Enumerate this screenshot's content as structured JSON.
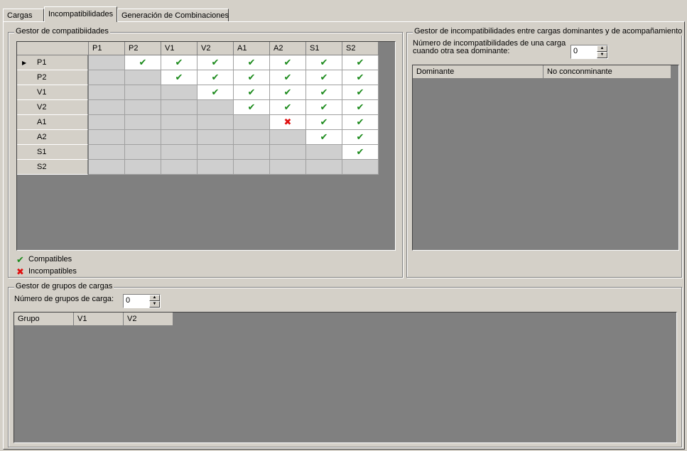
{
  "tabs": [
    {
      "label": "Cargas"
    },
    {
      "label": "Incompatibilidades"
    },
    {
      "label": "Generación de Combinaciones"
    }
  ],
  "compat": {
    "title": "Gestor de compatibiidades",
    "columns": [
      "P1",
      "P2",
      "V1",
      "V2",
      "A1",
      "A2",
      "S1",
      "S2"
    ],
    "rows": [
      {
        "label": "P1",
        "cells": [
          "",
          "ok",
          "ok",
          "ok",
          "ok",
          "ok",
          "ok",
          "ok"
        ]
      },
      {
        "label": "P2",
        "cells": [
          "",
          "",
          "ok",
          "ok",
          "ok",
          "ok",
          "ok",
          "ok"
        ]
      },
      {
        "label": "V1",
        "cells": [
          "",
          "",
          "",
          "ok",
          "ok",
          "ok",
          "ok",
          "ok"
        ]
      },
      {
        "label": "V2",
        "cells": [
          "",
          "",
          "",
          "",
          "ok",
          "ok",
          "ok",
          "ok"
        ]
      },
      {
        "label": "A1",
        "cells": [
          "",
          "",
          "",
          "",
          "",
          "bad",
          "ok",
          "ok"
        ]
      },
      {
        "label": "A2",
        "cells": [
          "",
          "",
          "",
          "",
          "",
          "",
          "ok",
          "ok"
        ]
      },
      {
        "label": "S1",
        "cells": [
          "",
          "",
          "",
          "",
          "",
          "",
          "",
          "ok"
        ]
      },
      {
        "label": "S2",
        "cells": [
          "",
          "",
          "",
          "",
          "",
          "",
          "",
          ""
        ]
      }
    ],
    "legend_compatible": "Compatibles",
    "legend_incompatible": "Incompatibles"
  },
  "incompat": {
    "title": "Gestor de incompatibilidades entre cargas dominantes y de acompañamiento",
    "count_label_1": "Número de incompatibilidades de una carga",
    "count_label_2": "cuando otra sea dominante:",
    "count_value": "0",
    "columns": [
      "Dominante",
      "No conconminante"
    ]
  },
  "groups": {
    "title": "Gestor de grupos de cargas",
    "count_label": "Número de grupos de carga:",
    "count_value": "0",
    "columns": [
      "Grupo",
      "V1",
      "V2"
    ]
  }
}
